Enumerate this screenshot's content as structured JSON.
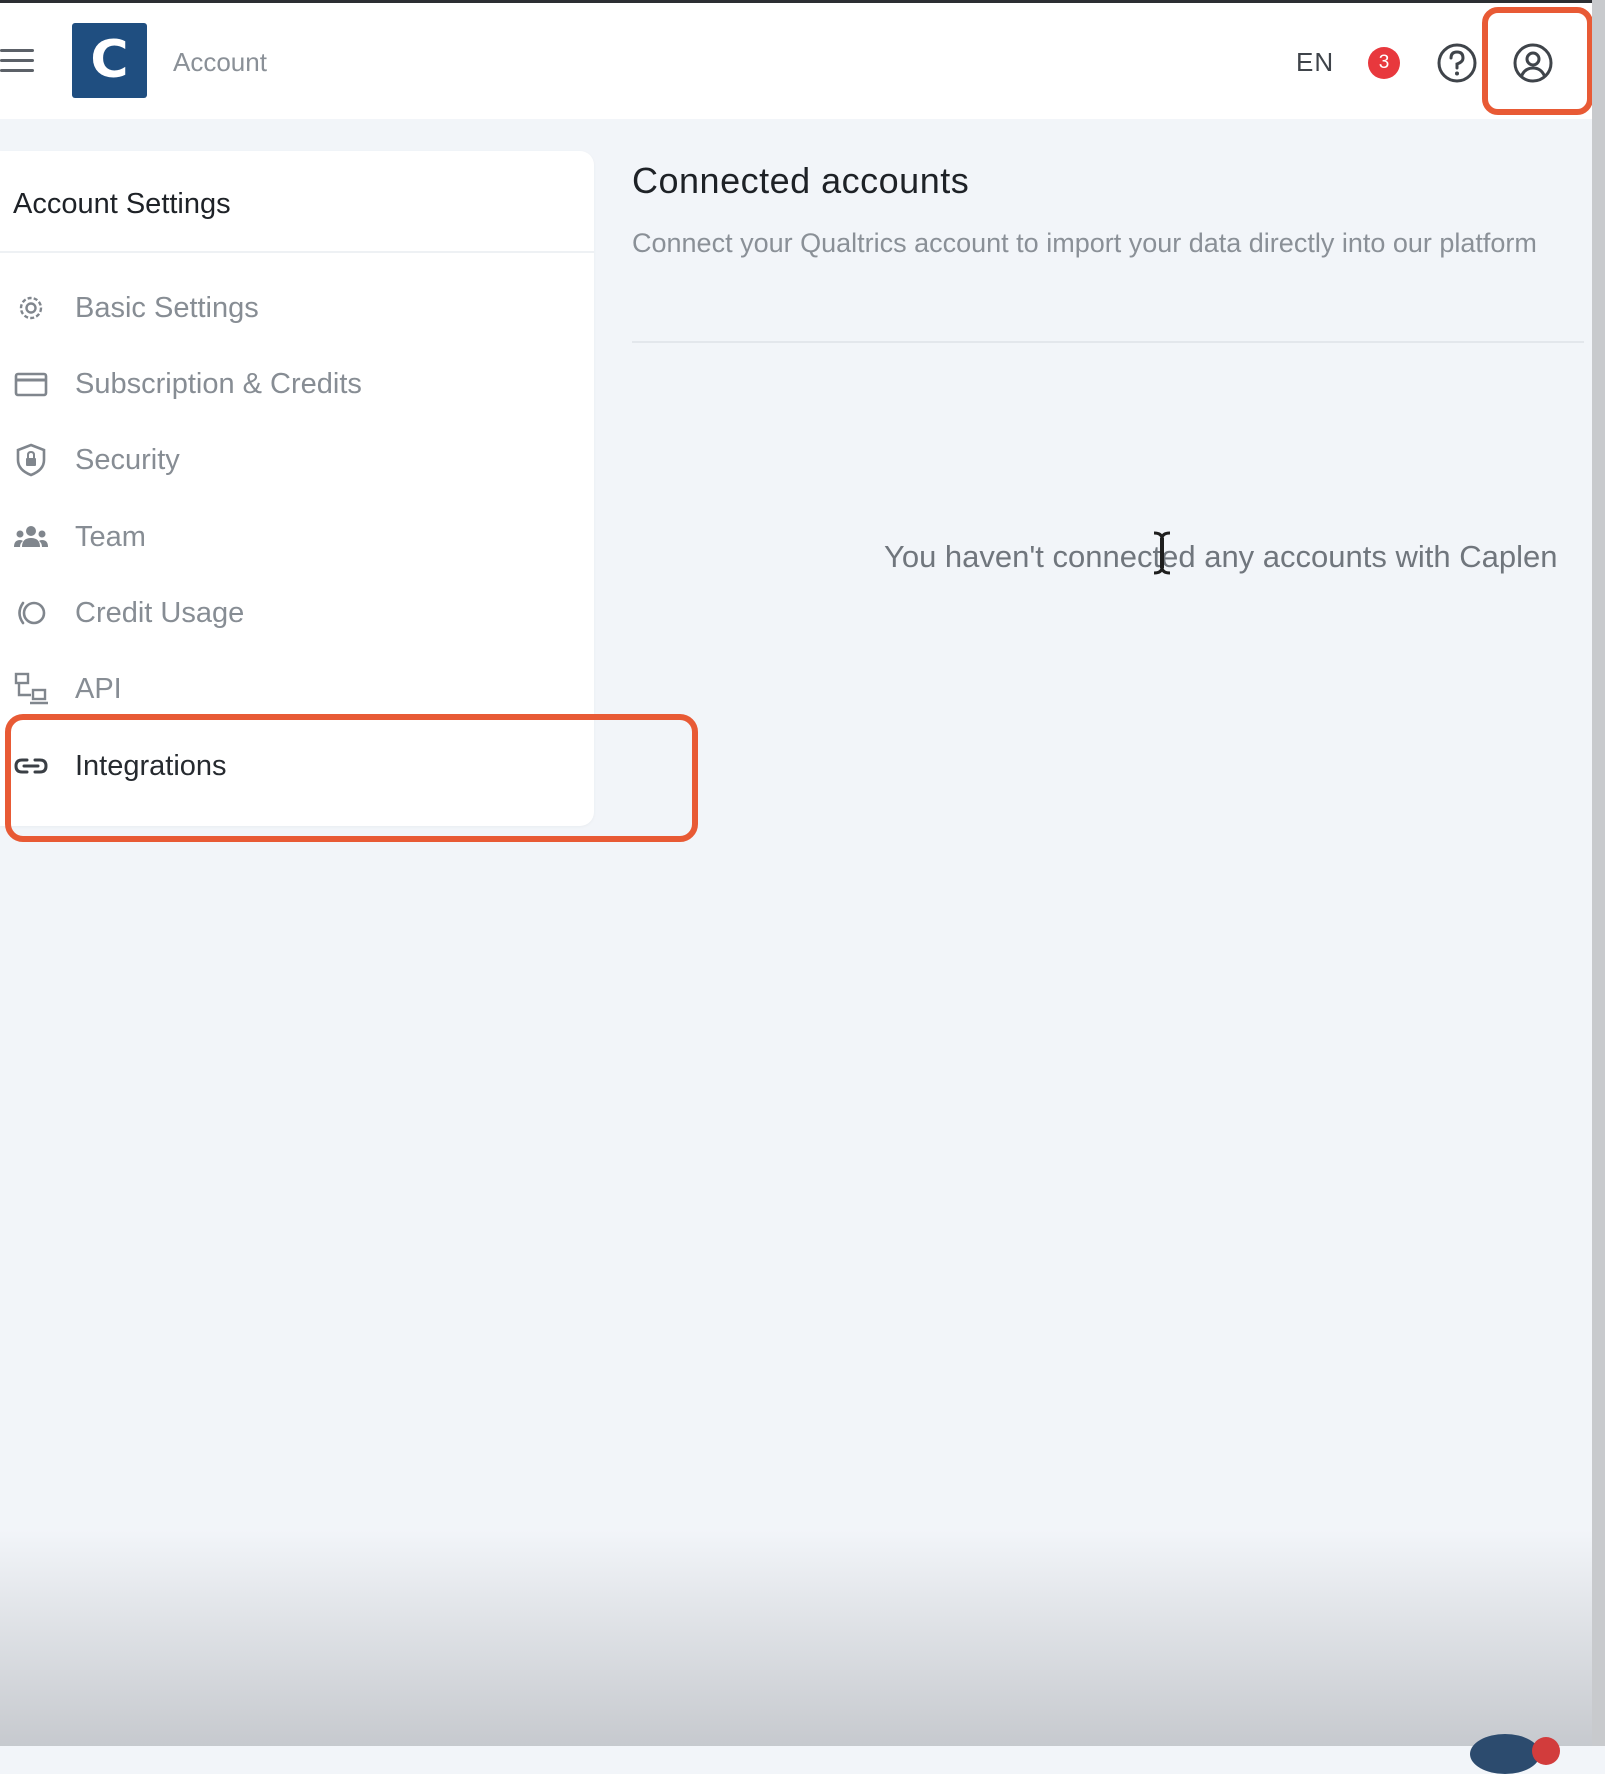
{
  "header": {
    "logo_letter": "C",
    "page_label": "Account",
    "language": "EN",
    "notification_count": "3",
    "icons": {
      "menu": "hamburger-menu-icon",
      "help": "question-circle-icon",
      "account": "user-circle-icon"
    }
  },
  "sidebar": {
    "title": "Account Settings",
    "items": [
      {
        "label": "Basic Settings",
        "icon": "gear-icon",
        "active": false
      },
      {
        "label": "Subscription & Credits",
        "icon": "credit-card-icon",
        "active": false
      },
      {
        "label": "Security",
        "icon": "shield-lock-icon",
        "active": false
      },
      {
        "label": "Team",
        "icon": "team-icon",
        "active": false
      },
      {
        "label": "Credit Usage",
        "icon": "credit-usage-icon",
        "active": false
      },
      {
        "label": "API",
        "icon": "api-icon",
        "active": false
      },
      {
        "label": "Integrations",
        "icon": "link-icon",
        "active": true
      }
    ]
  },
  "main": {
    "title": "Connected accounts",
    "description": "Connect your Qualtrics account to import your data directly into our platform",
    "empty_message": "You haven't connected any accounts with Caplen"
  },
  "colors": {
    "brand": "#1f4e80",
    "badge": "#e8383d",
    "highlight": "#e85a35",
    "page_background": "#f2f5f9"
  }
}
